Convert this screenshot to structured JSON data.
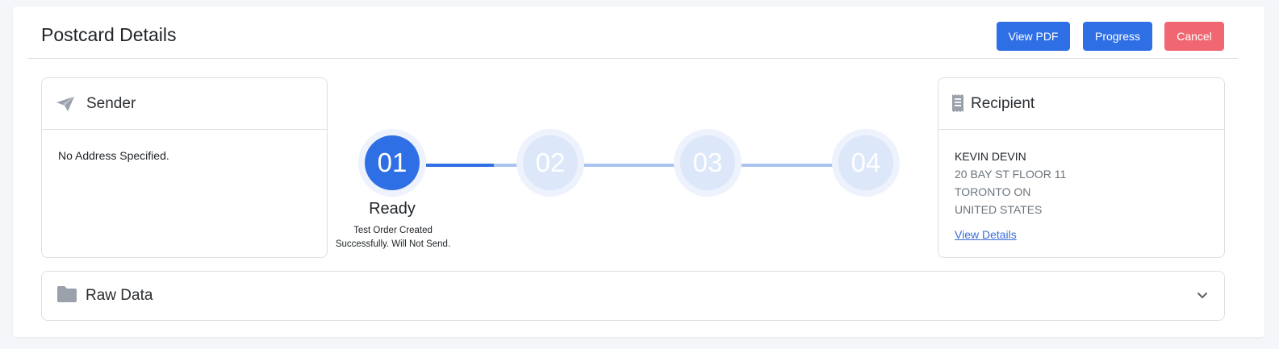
{
  "header": {
    "title": "Postcard Details",
    "buttons": {
      "view_pdf": "View PDF",
      "progress": "Progress",
      "cancel": "Cancel"
    }
  },
  "sender": {
    "title": "Sender",
    "icon": "paper-plane-icon",
    "body": "No Address Specified."
  },
  "recipient": {
    "title": "Recipient",
    "icon": "receipt-icon",
    "name": "KEVIN DEVIN",
    "address_lines": [
      "20 BAY ST FLOOR 11",
      "TORONTO ON",
      "UNITED STATES"
    ],
    "link": "View Details"
  },
  "progress": {
    "steps": [
      "01",
      "02",
      "03",
      "04"
    ],
    "current_step": 1,
    "current_label": "Ready",
    "current_description": "Test Order Created Successfully. Will Not Send."
  },
  "raw_data": {
    "title": "Raw Data",
    "icon": "folder-icon",
    "toggle_icon": "chevron-down-icon"
  },
  "colors": {
    "primary": "#2f6fe6",
    "danger": "#f06772",
    "step_inactive": "#dce7fa",
    "connector": "#a9c4ee"
  }
}
